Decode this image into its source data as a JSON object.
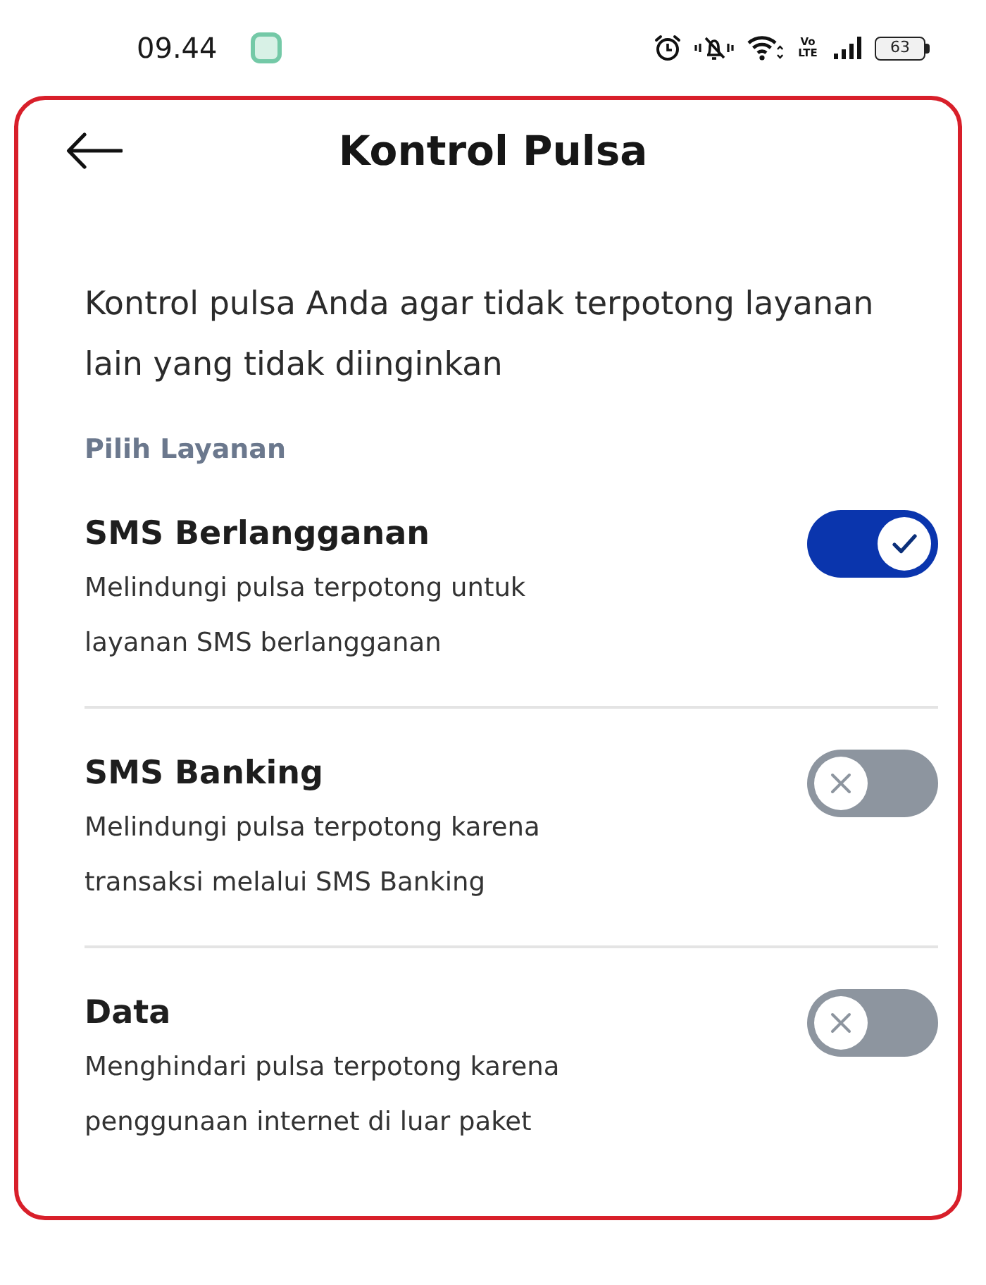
{
  "status_bar": {
    "time": "09.44",
    "network_label": "Vo LTE",
    "battery": "63"
  },
  "header": {
    "title": "Kontrol Pulsa"
  },
  "intro": "Kontrol pulsa Anda agar tidak terpotong layanan lain yang tidak diinginkan",
  "section_label": "Pilih Layanan",
  "services": [
    {
      "title": "SMS Berlangganan",
      "description": "Melindungi pulsa terpotong untuk layanan SMS berlangganan",
      "on": true
    },
    {
      "title": "SMS Banking",
      "description": "Melindungi pulsa terpotong karena transaksi melalui SMS Banking",
      "on": false
    },
    {
      "title": "Data",
      "description": "Menghindari pulsa terpotong karena penggunaan internet di luar paket",
      "on": false
    }
  ]
}
